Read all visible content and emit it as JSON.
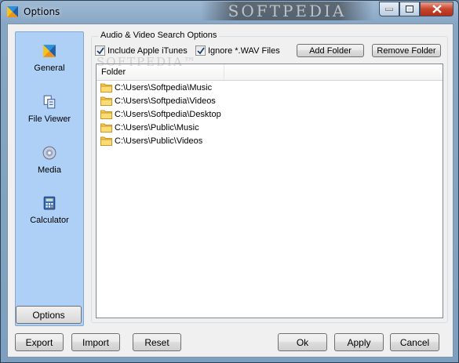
{
  "window": {
    "title": "Options",
    "watermark": "SOFTPEDIA"
  },
  "sidebar": {
    "items": [
      {
        "label": "General",
        "icon": "general-icon"
      },
      {
        "label": "File Viewer",
        "icon": "file-viewer-icon"
      },
      {
        "label": "Media",
        "icon": "media-icon"
      },
      {
        "label": "Calculator",
        "icon": "calculator-icon"
      }
    ],
    "options_label": "Options"
  },
  "group": {
    "title": "Audio & Video Search Options",
    "include_itunes_label": "Include Apple iTunes",
    "include_itunes_checked": true,
    "ignore_wav_label": "Ignore *.WAV Files",
    "ignore_wav_checked": true,
    "add_folder_label": "Add Folder",
    "remove_folder_label": "Remove Folder"
  },
  "list": {
    "column_header": "Folder",
    "watermark": "SOFTPEDIA™",
    "rows": [
      "C:\\Users\\Softpedia\\Music",
      "C:\\Users\\Softpedia\\Videos",
      "C:\\Users\\Softpedia\\Desktop",
      "C:\\Users\\Public\\Music",
      "C:\\Users\\Public\\Videos"
    ]
  },
  "footer": {
    "export_label": "Export",
    "import_label": "Import",
    "reset_label": "Reset",
    "ok_label": "Ok",
    "apply_label": "Apply",
    "cancel_label": "Cancel"
  },
  "colors": {
    "sidebar_bg": "#aed0f7",
    "folder_yellow": "#f5c94b"
  }
}
